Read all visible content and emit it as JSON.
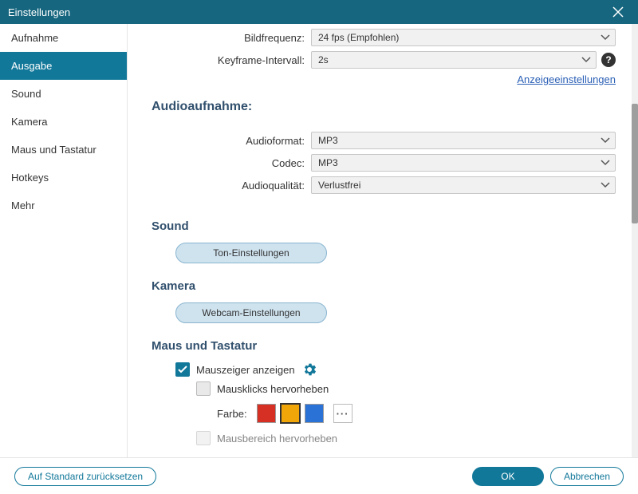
{
  "window": {
    "title": "Einstellungen"
  },
  "sidebar": {
    "items": [
      {
        "label": "Aufnahme"
      },
      {
        "label": "Ausgabe"
      },
      {
        "label": "Sound"
      },
      {
        "label": "Kamera"
      },
      {
        "label": "Maus und Tastatur"
      },
      {
        "label": "Hotkeys"
      },
      {
        "label": "Mehr"
      }
    ],
    "active_index": 1
  },
  "video": {
    "framerate_label": "Bildfrequenz:",
    "framerate_value": "24 fps (Empfohlen)",
    "keyframe_label": "Keyframe-Intervall:",
    "keyframe_value": "2s",
    "display_settings_link": "Anzeigeeinstellungen"
  },
  "audio_rec": {
    "heading": "Audioaufnahme:",
    "format_label": "Audioformat:",
    "format_value": "MP3",
    "codec_label": "Codec:",
    "codec_value": "MP3",
    "quality_label": "Audioqualität:",
    "quality_value": "Verlustfrei"
  },
  "sound": {
    "heading": "Sound",
    "button": "Ton-Einstellungen"
  },
  "camera": {
    "heading": "Kamera",
    "button": "Webcam-Einstellungen"
  },
  "mouse": {
    "heading": "Maus und Tastatur",
    "show_cursor": "Mauszeiger anzeigen",
    "highlight_clicks": "Mausklicks hervorheben",
    "color_label": "Farbe:",
    "colors": [
      "#d63024",
      "#f0a609",
      "#2a72d6"
    ],
    "highlight_area": "Mausbereich hervorheben"
  },
  "footer": {
    "reset": "Auf Standard zurücksetzen",
    "ok": "OK",
    "cancel": "Abbrechen"
  }
}
